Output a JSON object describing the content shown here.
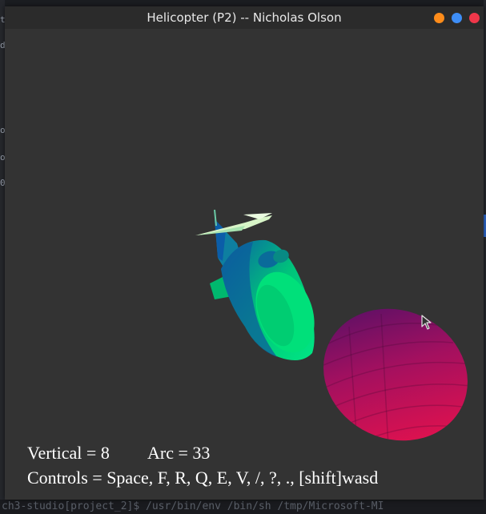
{
  "window": {
    "title": "Helicopter (P2) -- Nicholas Olson",
    "buttons": {
      "minimize_color": "#ff8c1a",
      "maximize_color": "#3e8ef7",
      "close_color": "#f0374a"
    }
  },
  "hud": {
    "vertical_label": "Vertical = 8",
    "arc_label": "Arc = 33",
    "controls_label": "Controls = Space, F, R, Q, E, V, /, ?, ., [shift]wasd"
  },
  "scene": {
    "background_color": "#333333",
    "helicopter_color": "#00e07a",
    "helicopter_shadow_color": "#0d5fa8",
    "rotor_color": "#d8f5c8",
    "sphere_colors": [
      "#5a1070",
      "#e8104a"
    ]
  },
  "background": {
    "bottom_text": "ch3-studio[project_2]$  /usr/bin/env /bin/sh /tmp/Microsoft-MI"
  }
}
